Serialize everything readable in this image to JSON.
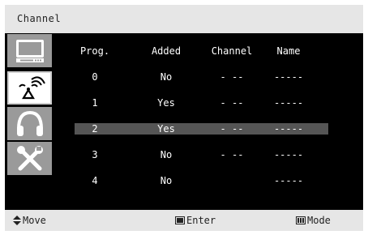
{
  "title": "Channel",
  "sidebar": {
    "items": [
      {
        "icon": "tv-icon",
        "active": false
      },
      {
        "icon": "antenna-icon",
        "active": true
      },
      {
        "icon": "headphones-icon",
        "active": false
      },
      {
        "icon": "tools-icon",
        "active": false
      }
    ]
  },
  "table": {
    "headers": [
      "Prog.",
      "Added",
      "Channel",
      "Name"
    ],
    "rows": [
      {
        "prog": "0",
        "added": "No",
        "channel": "- --",
        "name": "-----"
      },
      {
        "prog": "1",
        "added": "Yes",
        "channel": "- --",
        "name": "-----"
      },
      {
        "prog": "2",
        "added": "Yes",
        "channel": "- --",
        "name": "-----",
        "selected": true
      },
      {
        "prog": "3",
        "added": "No",
        "channel": "- --",
        "name": "-----"
      },
      {
        "prog": "4",
        "added": "No",
        "channel": "",
        "name": "-----"
      }
    ]
  },
  "footer": {
    "move_label": "Move",
    "enter_label": "Enter",
    "mode_label": "Mode"
  },
  "colors": {
    "background": "#000000",
    "bars": "#e6e6e6",
    "selected_row": "#555555",
    "icon_tile": "#9a9a9a"
  }
}
